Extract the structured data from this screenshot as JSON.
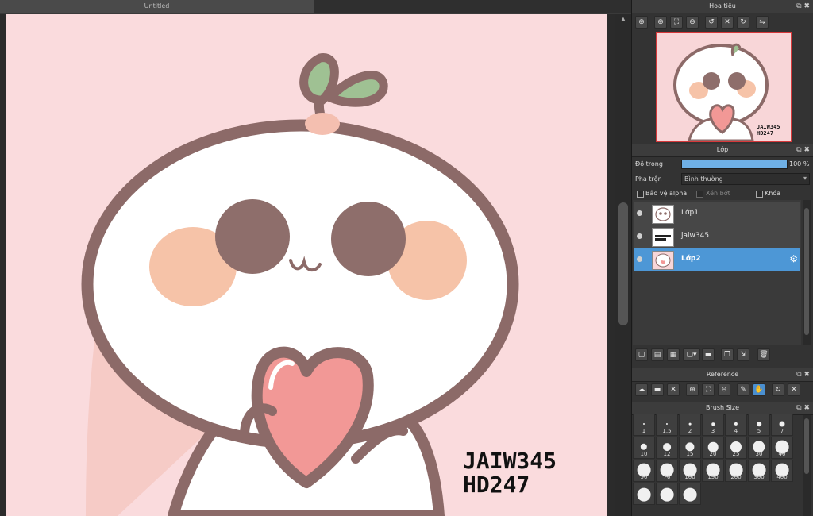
{
  "document": {
    "tab_title": "Untitled"
  },
  "canvas": {
    "watermark_line1": "JAIW345",
    "watermark_line2": "HD247",
    "background": "#fadbdd"
  },
  "navigator": {
    "title": "Hoa tiêu",
    "tools": [
      "zoom-in-icon",
      "zoom-in-icon",
      "fit-icon",
      "zoom-out-icon",
      "rotate-left-icon",
      "actual-size-icon",
      "rotate-right-icon",
      "flip-icon"
    ],
    "preview_text1": "JAIW345",
    "preview_text2": "HD247"
  },
  "layers_panel": {
    "title": "Lớp",
    "opacity_label": "Độ trong",
    "opacity_value": "100 %",
    "opacity_fraction": 1.0,
    "blend_label": "Pha trộn",
    "blend_value": "Bình thường",
    "protect_alpha": "Bảo vệ alpha",
    "clipping": "Xén bớt",
    "lock": "Khóa",
    "layers": [
      {
        "name": "Lớp1",
        "selected": false
      },
      {
        "name": "jaiw345",
        "selected": false
      },
      {
        "name": "Lớp2",
        "selected": true
      }
    ]
  },
  "reference": {
    "title": "Reference"
  },
  "brush_size": {
    "title": "Brush Size",
    "sizes": [
      "1",
      "1.5",
      "2",
      "3",
      "4",
      "5",
      "7",
      "10",
      "12",
      "15",
      "20",
      "25",
      "30",
      "40",
      "50",
      "70",
      "100",
      "150",
      "200",
      "300",
      "400",
      "",
      "",
      ""
    ]
  },
  "colors": {
    "accent": "#4d97d6",
    "panel": "#333333",
    "highlight": "#d6383a"
  }
}
